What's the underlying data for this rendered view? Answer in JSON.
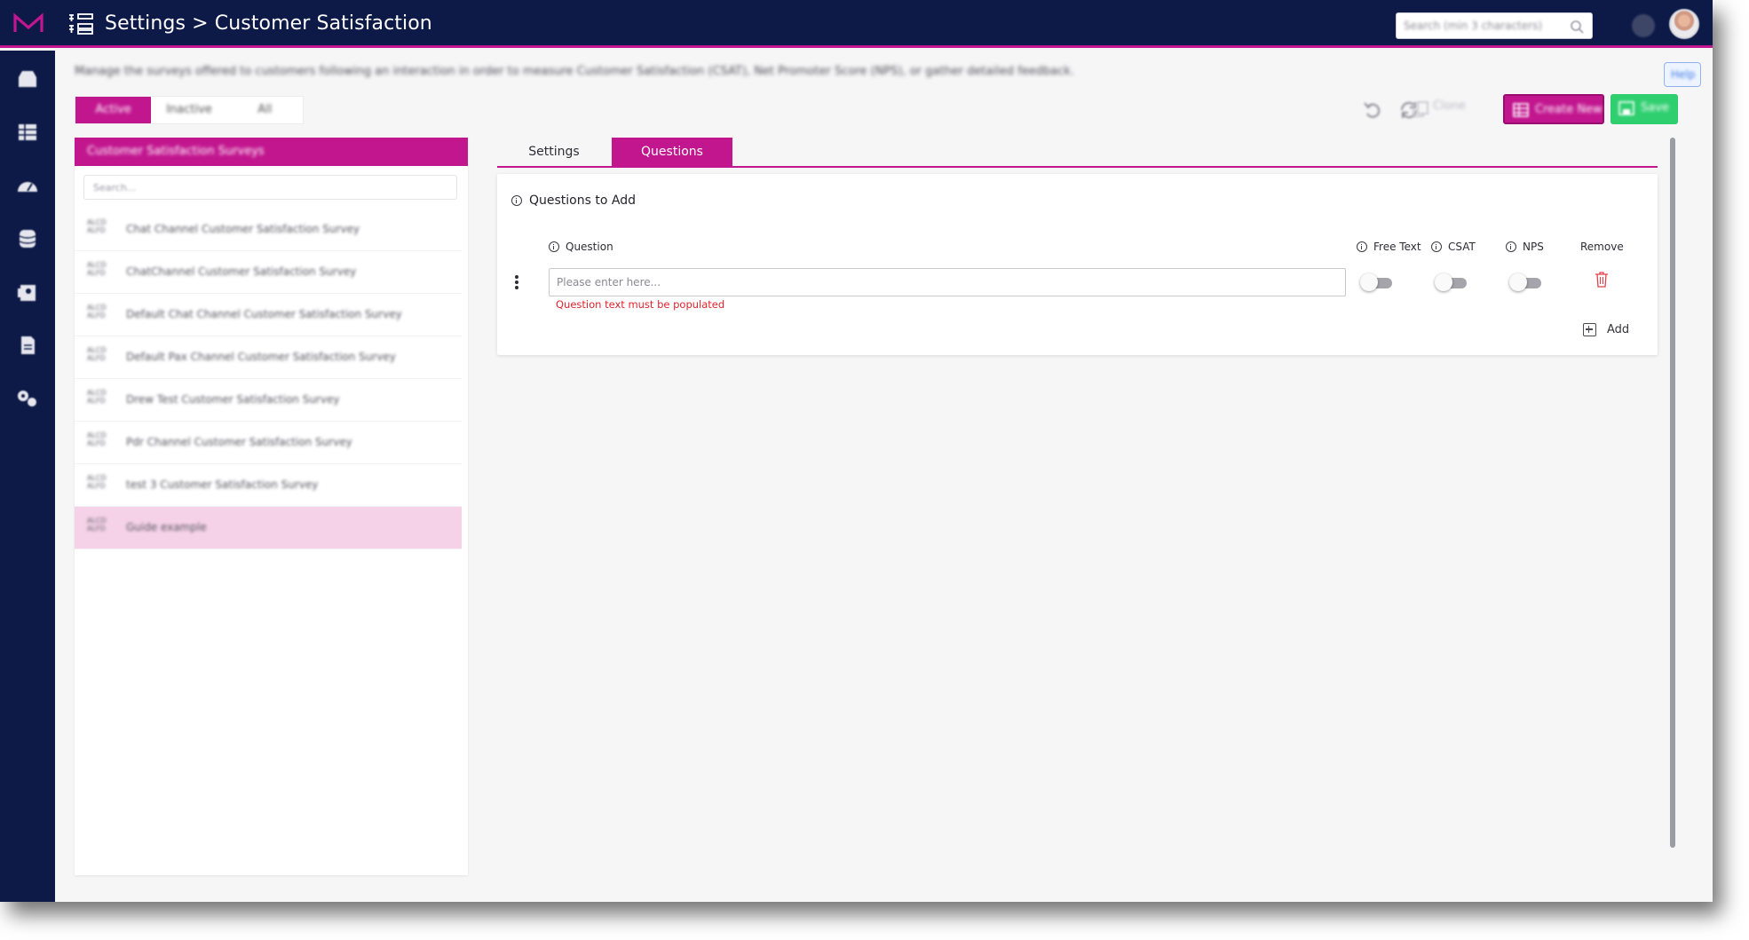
{
  "header": {
    "title": "Settings > Customer Satisfaction",
    "search_placeholder": "Search (min 3 characters)"
  },
  "page": {
    "description": "Manage the surveys offered to customers following an interaction in order to measure Customer Satisfaction (CSAT), Net Promoter Score (NPS), or gather detailed feedback.",
    "help_label": "Help"
  },
  "filter_tabs": {
    "active": "Active",
    "inactive": "Inactive",
    "all": "All"
  },
  "toolbar": {
    "clone_label": "Clone",
    "create_label": "Create New",
    "save_label": "Save"
  },
  "survey_panel": {
    "title": "Customer Satisfaction Surveys",
    "search_placeholder": "Search...",
    "items": [
      {
        "id": "ALCD ALFD",
        "name": "Chat Channel Customer Satisfaction Survey"
      },
      {
        "id": "ALCD ALFD",
        "name": "ChatChannel Customer Satisfaction Survey"
      },
      {
        "id": "ALCD ALFD",
        "name": "Default Chat Channel Customer Satisfaction Survey"
      },
      {
        "id": "ALCD ALFD",
        "name": "Default Pax Channel Customer Satisfaction Survey"
      },
      {
        "id": "ALCD ALFD",
        "name": "Drew Test Customer Satisfaction Survey"
      },
      {
        "id": "ALCD ALFD",
        "name": "Pdr Channel Customer Satisfaction Survey"
      },
      {
        "id": "ALCD ALFD",
        "name": "test 3 Customer Satisfaction Survey"
      },
      {
        "id": "ALCD ALFD",
        "name": "Guide example"
      }
    ],
    "selected_index": 7
  },
  "tabs": {
    "settings": "Settings",
    "questions": "Questions"
  },
  "questions_card": {
    "title": "Questions to Add",
    "col_question": "Question",
    "col_free_text": "Free Text",
    "col_csat": "CSAT",
    "col_nps": "NPS",
    "col_remove": "Remove",
    "input_placeholder": "Please enter here...",
    "input_value": "",
    "error_text": "Question text must be populated",
    "free_text_on": false,
    "csat_on": false,
    "nps_on": false,
    "add_label": "Add"
  },
  "colors": {
    "navy": "#0d1a48",
    "accent": "#c2168f",
    "save_green": "#2fcf70",
    "error_red": "#e0242e"
  }
}
